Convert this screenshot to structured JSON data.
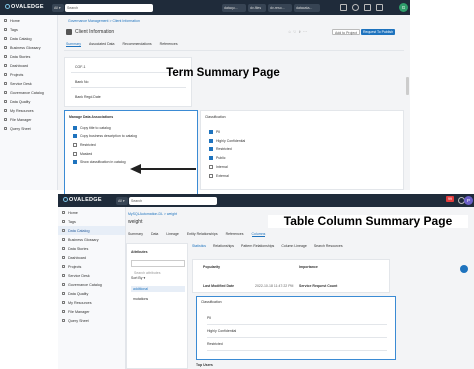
{
  "top": {
    "app_name": "OVALEDGE",
    "search_scope": "All",
    "search_placeholder": "Search",
    "tabs": [
      "dataqu...",
      "dv-files",
      "dv-reso...",
      "datacata..."
    ],
    "user_initial": "G",
    "breadcrumb": "Governance Management > Client Information",
    "page_title": "Client Information",
    "tabs_row": [
      "Summary",
      "Associated Data",
      "Recommendations",
      "References"
    ],
    "add_to_project": "Add to Project",
    "request_publish": "Request To Publish",
    "fields": [
      "COF-1",
      "Bank No",
      "Bank Regd.Date"
    ],
    "caption": "Term Summary Page",
    "data_assoc_title": "Manage Data Associations",
    "data_assoc": [
      {
        "label": "Copy title to catalog",
        "checked": true
      },
      {
        "label": "Copy business description to catalog",
        "checked": true
      },
      {
        "label": "Restricted",
        "checked": false
      },
      {
        "label": "Masked",
        "checked": false
      },
      {
        "label": "Show classification in catalog",
        "checked": true
      }
    ],
    "classification_title": "Classification",
    "classification": [
      {
        "label": "PII",
        "checked": true
      },
      {
        "label": "Highly Confidential",
        "checked": true
      },
      {
        "label": "Restricted",
        "checked": true
      },
      {
        "label": "Public",
        "checked": true
      },
      {
        "label": "Internal",
        "checked": false
      },
      {
        "label": "External",
        "checked": false
      }
    ]
  },
  "sidebar_top": [
    {
      "label": "Home",
      "icon": "home-icon"
    },
    {
      "label": "Tags",
      "icon": "tag-icon"
    },
    {
      "label": "Data Catalog",
      "icon": "catalog-icon"
    },
    {
      "label": "Business Glossary",
      "icon": "glossary-icon"
    },
    {
      "label": "Data Stories",
      "icon": "stories-icon"
    },
    {
      "label": "Dashboard",
      "icon": "dashboard-icon"
    },
    {
      "label": "Projects",
      "icon": "projects-icon"
    },
    {
      "label": "Service Desk",
      "icon": "service-icon"
    },
    {
      "label": "Governance Catalog",
      "icon": "governance-icon"
    },
    {
      "label": "Data Quality",
      "icon": "quality-icon"
    },
    {
      "label": "My Resources",
      "icon": "resources-icon"
    },
    {
      "label": "File Manager",
      "icon": "file-icon"
    },
    {
      "label": "Query Sheet",
      "icon": "query-icon"
    }
  ],
  "bottom": {
    "app_name": "OVALEDGE",
    "search_scope": "All",
    "search_placeholder": "Search",
    "badge": "99",
    "user_initial": "P",
    "breadcrumb": "MySQLAutomation-DL > weight",
    "title": "weight",
    "tabs_row": [
      "Summary",
      "Data",
      "Lineage",
      "Entity Relationships",
      "References",
      "Columns"
    ],
    "subtabs": [
      "Statistics",
      "Relationships",
      "Pattern Relationships",
      "Column Lineage",
      "Search Resources"
    ],
    "attributes_title": "Attributes",
    "search_attr_placeholder": "Search attributes",
    "sort_by": "Sort By",
    "attr_items": [
      "additional",
      "mutations"
    ],
    "popularity": "Popularity",
    "importance": "Importance",
    "last_modified": "Last Modified Date",
    "last_modified_value": "2022-10-18 11:47:22 PM",
    "service_request": "Service Request Count",
    "classification_title": "Classification",
    "classification": [
      "PII",
      "Highly Confidential",
      "Restricted"
    ],
    "top_users": "Top Users",
    "caption": "Table Column Summary Page"
  },
  "sidebar_bottom": [
    {
      "label": "Home",
      "icon": "home-icon"
    },
    {
      "label": "Tags",
      "icon": "tag-icon"
    },
    {
      "label": "Data Catalog",
      "icon": "catalog-icon",
      "active": true
    },
    {
      "label": "Business Glossary",
      "icon": "glossary-icon"
    },
    {
      "label": "Data Stories",
      "icon": "stories-icon"
    },
    {
      "label": "Dashboard",
      "icon": "dashboard-icon"
    },
    {
      "label": "Projects",
      "icon": "projects-icon"
    },
    {
      "label": "Service Desk",
      "icon": "service-icon"
    },
    {
      "label": "Governance Catalog",
      "icon": "governance-icon"
    },
    {
      "label": "Data Quality",
      "icon": "quality-icon"
    },
    {
      "label": "My Resources",
      "icon": "resources-icon"
    },
    {
      "label": "File Manager",
      "icon": "file-icon"
    },
    {
      "label": "Query Sheet",
      "icon": "query-icon"
    }
  ]
}
